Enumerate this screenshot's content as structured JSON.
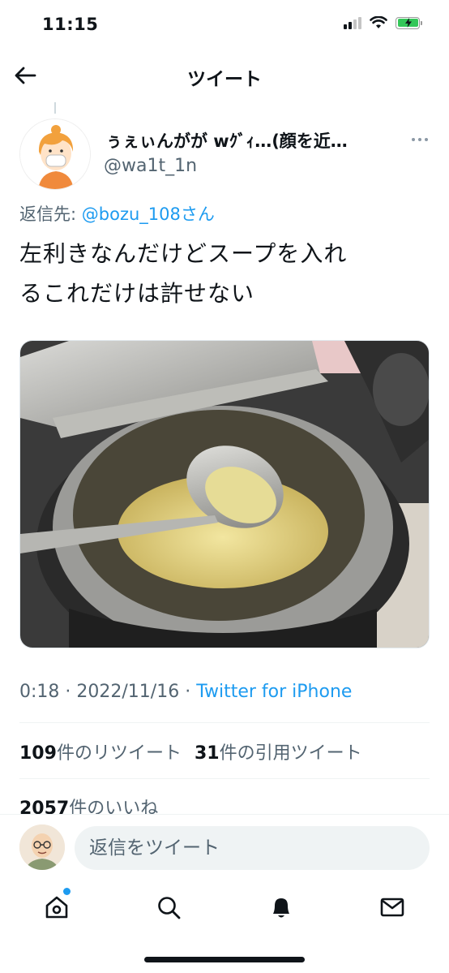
{
  "status_bar": {
    "time": "11:15"
  },
  "header": {
    "title": "ツイート"
  },
  "tweet": {
    "display_name": "ぅぇぃんがが wｸﾞｨ…(顔を近…",
    "handle": "@wa1t_1n",
    "reply_label": "返信先: ",
    "reply_mention": "@bozu_108さん",
    "text_line1": "左利きなんだけどスープを入れ",
    "text_line2": "るこれだけは許せない",
    "time": "0:18",
    "date": "2022/11/16",
    "source": "Twitter for iPhone",
    "retweet_count": "109",
    "retweet_label": "件のリツイート",
    "quote_count": "31",
    "quote_label": "件の引用ツイート",
    "like_count": "2057",
    "like_label": "件のいいね"
  },
  "reply_bar": {
    "placeholder": "返信をツイート"
  },
  "colors": {
    "accent": "#1d9bf0",
    "secondary_text": "#536471",
    "battery": "#34c759"
  },
  "icons": [
    "back-arrow-icon",
    "more-icon",
    "home-icon",
    "search-icon",
    "bell-icon",
    "mail-icon"
  ]
}
